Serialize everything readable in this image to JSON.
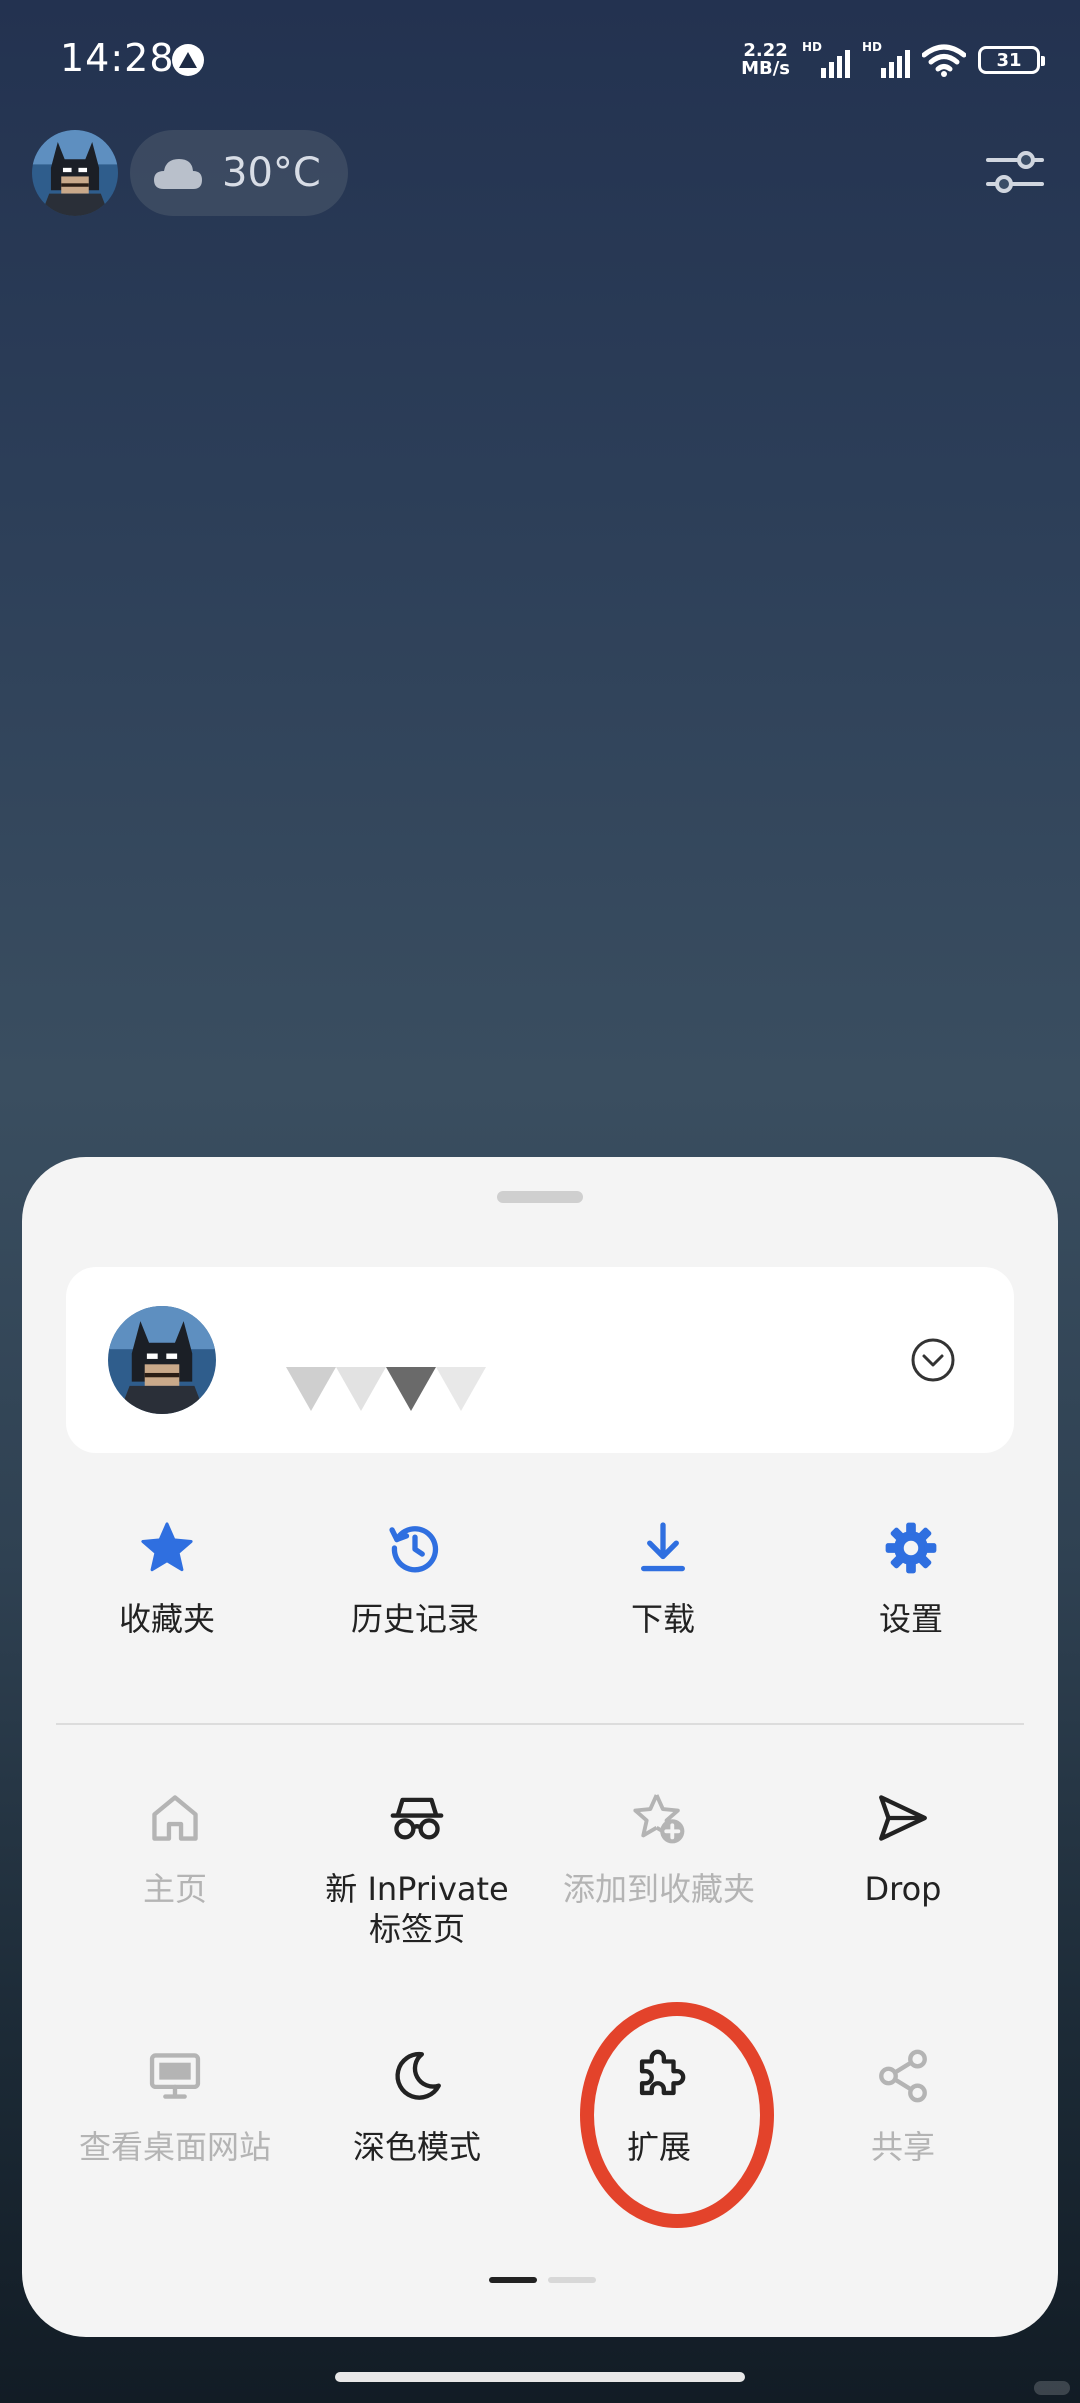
{
  "status_bar": {
    "time": "14:28",
    "net_speed_value": "2.22",
    "net_speed_unit": "MB/s",
    "sim1_label": "HD",
    "sim2_label": "HD",
    "battery": "31"
  },
  "weather": {
    "temperature": "30°C",
    "condition_icon": "cloud-icon"
  },
  "menu": {
    "quick_actions": [
      {
        "label": "收藏夹",
        "icon": "star-icon"
      },
      {
        "label": "历史记录",
        "icon": "history-icon"
      },
      {
        "label": "下载",
        "icon": "download-icon"
      },
      {
        "label": "设置",
        "icon": "gear-icon"
      }
    ],
    "row2": [
      {
        "label": "主页",
        "icon": "home-icon",
        "enabled": false
      },
      {
        "label": "新 InPrivate\n标签页",
        "icon": "inprivate-icon",
        "enabled": true
      },
      {
        "label": "添加到收藏夹",
        "icon": "add-favorite-icon",
        "enabled": false
      },
      {
        "label": "Drop",
        "icon": "send-icon",
        "enabled": true
      }
    ],
    "row3": [
      {
        "label": "查看桌面网站",
        "icon": "desktop-icon",
        "enabled": false
      },
      {
        "label": "深色模式",
        "icon": "moon-icon",
        "enabled": true
      },
      {
        "label": "扩展",
        "icon": "puzzle-icon",
        "enabled": true
      },
      {
        "label": "共享",
        "icon": "share-icon",
        "enabled": false
      }
    ],
    "page_indicator": {
      "current": 1,
      "total": 2
    }
  },
  "colors": {
    "accent_blue": "#2f6fe0",
    "annotation_red": "#e3432b",
    "disabled_gray": "#b4b4b4"
  }
}
